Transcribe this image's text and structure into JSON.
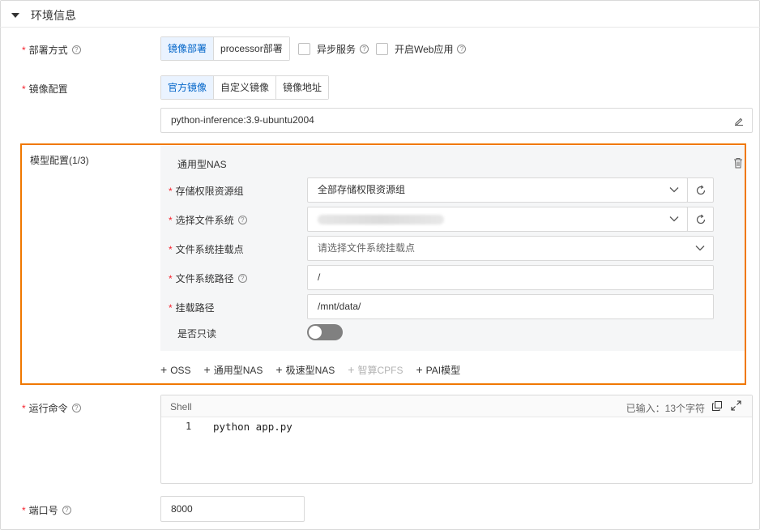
{
  "section": {
    "title": "环境信息"
  },
  "deploy": {
    "label": "部署方式",
    "options": [
      "镜像部署",
      "processor部署"
    ],
    "selected": "镜像部署",
    "async_label": "异步服务",
    "web_label": "开启Web应用"
  },
  "image": {
    "label": "镜像配置",
    "options": [
      "官方镜像",
      "自定义镜像",
      "镜像地址"
    ],
    "selected": "官方镜像",
    "value": "python-inference:3.9-ubuntu2004"
  },
  "model": {
    "label": "模型配置(1/3)",
    "panel_title": "通用型NAS",
    "storage_group": {
      "label": "存储权限资源组",
      "value": "全部存储权限资源组"
    },
    "filesystem": {
      "label": "选择文件系统",
      "value": ""
    },
    "mount_point": {
      "label": "文件系统挂载点",
      "placeholder": "请选择文件系统挂载点"
    },
    "fs_path": {
      "label": "文件系统路径",
      "value": "/"
    },
    "mount_path": {
      "label": "挂载路径",
      "value": "/mnt/data/"
    },
    "readonly": {
      "label": "是否只读",
      "on": false
    },
    "add_items": [
      {
        "label": "OSS",
        "disabled": false
      },
      {
        "label": "通用型NAS",
        "disabled": false
      },
      {
        "label": "极速型NAS",
        "disabled": false
      },
      {
        "label": "智算CPFS",
        "disabled": true
      },
      {
        "label": "PAI模型",
        "disabled": false
      }
    ]
  },
  "command": {
    "label": "运行命令",
    "lang": "Shell",
    "count_text": "已输入：13个字符",
    "line_number": "1",
    "code": "python app.py"
  },
  "port": {
    "label": "端口号",
    "value": "8000"
  },
  "colors": {
    "accent": "#0064c8",
    "highlight": "#f07800",
    "required": "#f5222d"
  }
}
